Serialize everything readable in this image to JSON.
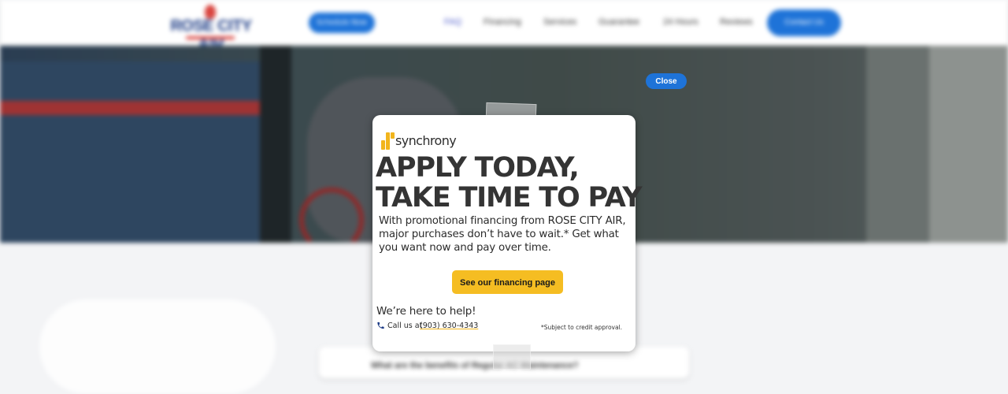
{
  "background_site": {
    "logo_text": "ROSE CITY AIR",
    "header_cta_label": "Schedule Now",
    "nav": [
      {
        "label": "FAQ"
      },
      {
        "label": "Financing"
      },
      {
        "label": "Services"
      },
      {
        "label": "Guarantee"
      },
      {
        "label": "24 Hours"
      },
      {
        "label": "Reviews"
      }
    ],
    "contact_label": "Contact Us",
    "faq_question": "What are the benefits of Regular AC Maintenance?"
  },
  "modal": {
    "close_label": "Close",
    "brand_name": "synchrony",
    "headline_line1": "APPLY TODAY,",
    "headline_line2": "TAKE TIME TO PAY",
    "body": "With promotional financing from ROSE CITY AIR, major purchases don’t have to wait.* Get what you want now and pay over time.",
    "cta_label": "See our financing page",
    "help_title": "We’re here to help!",
    "call_label": "Call us at",
    "phone": "(903) 630-4343",
    "disclaimer": "*Subject to credit approval."
  },
  "colors": {
    "brand_blue": "#1e73d8",
    "cta_yellow": "#f5bd22",
    "synchrony_gold": "#f2b51c",
    "logo_navy": "#1d3c86",
    "logo_red": "#d9453f"
  }
}
